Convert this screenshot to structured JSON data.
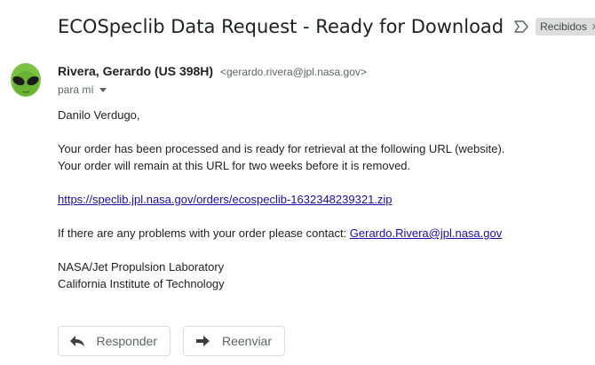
{
  "email": {
    "subject": "ECOSpeclib Data Request - Ready for Download",
    "label": "Recibidos",
    "label_close": "x",
    "sender_name": "Rivera, Gerardo (US 398H)",
    "sender_email": "<gerardo.rivera@jpl.nasa.gov>",
    "recipient": "para mí",
    "greeting": "Danilo Verdugo,",
    "line1": "Your order has been processed and is ready for retrieval at the following URL (website).",
    "line2": "Your order will remain at this URL for two weeks before it is removed.",
    "download_url": "https://speclib.jpl.nasa.gov/orders/ecospeclib-1632348239321.zip",
    "contact_text": "If there are any problems with your order please contact: ",
    "contact_email": "Gerardo.Rivera@jpl.nasa.gov",
    "signature_line1": "NASA/Jet Propulsion Laboratory",
    "signature_line2": "California Institute of Technology"
  },
  "actions": {
    "reply_label": "Responder",
    "forward_label": "Reenviar"
  },
  "icons": {
    "importance": "importance-marker-icon",
    "reply": "reply-arrow-icon",
    "forward": "forward-arrow-icon",
    "avatar": "alien-avatar"
  }
}
